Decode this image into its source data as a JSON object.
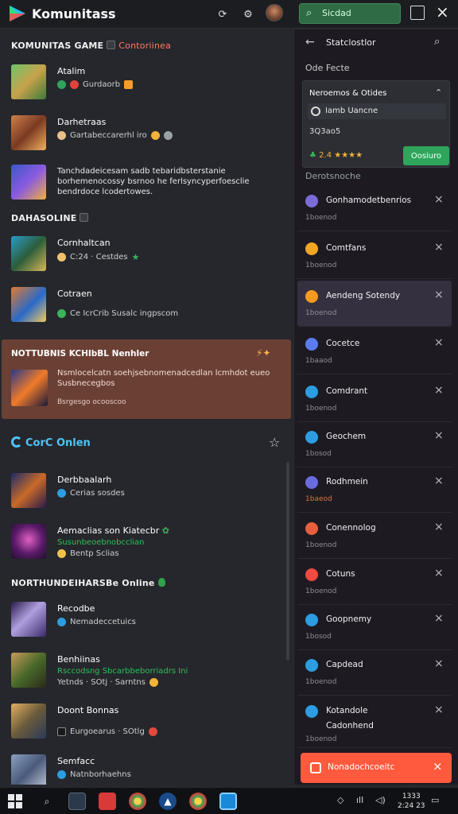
{
  "app": {
    "title": "Komunitass"
  },
  "topbar": {
    "search_text": "Sicdad",
    "icons": [
      "logo-icon",
      "refresh-icon",
      "settings-icon",
      "avatar",
      "search-icon",
      "grid-icon",
      "close-icon"
    ]
  },
  "left": {
    "section1": {
      "label": "KOMUNITAS GAME",
      "red_label": "Contoriinea"
    },
    "items1": [
      {
        "title": "Atalim",
        "sub": "",
        "meta": "Gurdaorb"
      },
      {
        "title": "Darhetraas",
        "meta": "Gartabeccarerhl iro"
      },
      {
        "desc": "Tanchdadeicesam sadb tebaridbsterstanie borhemenocossy bsrnoo he ferlsyncyperfoesclie bendrdoce lcodertowes."
      }
    ],
    "section2": {
      "label": "DAHASOLINE"
    },
    "items2": [
      {
        "title": "Cornhaltcan",
        "meta": "C:24 · Cestdes"
      },
      {
        "title": "Cotraen",
        "sub": "",
        "meta": "Ce IcrCrib Susalc ingpscom"
      }
    ],
    "featured": {
      "title": "NOTTUBNIS KCHIbBL Nenhler",
      "desc": "Nsmlocelcatn soehjsebnomenadcedlan lcmhdot eueo Susbnecegbos",
      "foot": "Bsrgesgo ocooscoo"
    },
    "co_online": {
      "label": "CorC Onlen"
    },
    "items3": [
      {
        "title": "Derbbaalarh",
        "meta": "Cerias sosdes"
      },
      {
        "title": "Aemaclias son Kiatecbr",
        "sub": "Susunbeoebnobcclian",
        "meta": "Bentp Sclias"
      }
    ],
    "section4": {
      "label": "NORTHUNDEIHARSBe Online"
    },
    "items4": [
      {
        "title": "Recodbe",
        "meta": "Nemadeccetuics"
      },
      {
        "title": "Benhiinas",
        "sub": "Rsccodsng Sbcarbbeborriadrs Ini",
        "meta": "Yetnds · SOtj · Sarntns"
      },
      {
        "title": "Doont Bonnas",
        "meta": "Eurgoearus · SOtlg"
      },
      {
        "title": "Semfacc",
        "meta": "Natnborhaehns"
      }
    ]
  },
  "right": {
    "header_title": "Statclostlor",
    "sub": "Ode Fecte",
    "notice": {
      "title": "Neroemos & Otides",
      "field": "Iamb Uancne",
      "value": "3Q3ao5",
      "rating": "2.4 ★★★★",
      "button": "Oosiuro"
    },
    "section": "Derotsnoche",
    "items": [
      {
        "title": "Gonhamodetbenrios",
        "sub": "1boenod",
        "color": "#7b6bd6"
      },
      {
        "title": "Comtfans",
        "sub": "1boenod",
        "color": "#f2a523"
      },
      {
        "title": "Aendeng Sotendy",
        "sub": "1boenod",
        "color": "#f59a1e",
        "selected": true
      },
      {
        "title": "Cocetce",
        "sub": "1baaod",
        "color": "#5b7cf0"
      },
      {
        "title": "Comdrant",
        "sub": "1boenod",
        "color": "#2b9de0"
      },
      {
        "title": "Geochem",
        "sub": "1bosod",
        "color": "#2b9de0"
      },
      {
        "title": "Rodhmein",
        "sub": "1baeod",
        "color": "#6b6be0",
        "orange_sub": true
      },
      {
        "title": "Conennolog",
        "sub": "1boenod",
        "color": "#ea5f3b"
      },
      {
        "title": "Cotuns",
        "sub": "1boenod",
        "color": "#ef4a3f"
      },
      {
        "title": "Goopnemy",
        "sub": "1bosod",
        "color": "#2b9de0"
      },
      {
        "title": "Capdead",
        "sub": "1boenod",
        "color": "#2b9de0"
      },
      {
        "title": "Kotandole",
        "title2": "Cadonhend",
        "sub": "1boenod",
        "color": "#2b9de0"
      }
    ],
    "toast": {
      "text": "Nonadochcoeitc"
    }
  },
  "taskbar": {
    "time": "1333",
    "date": "2:24 23"
  }
}
